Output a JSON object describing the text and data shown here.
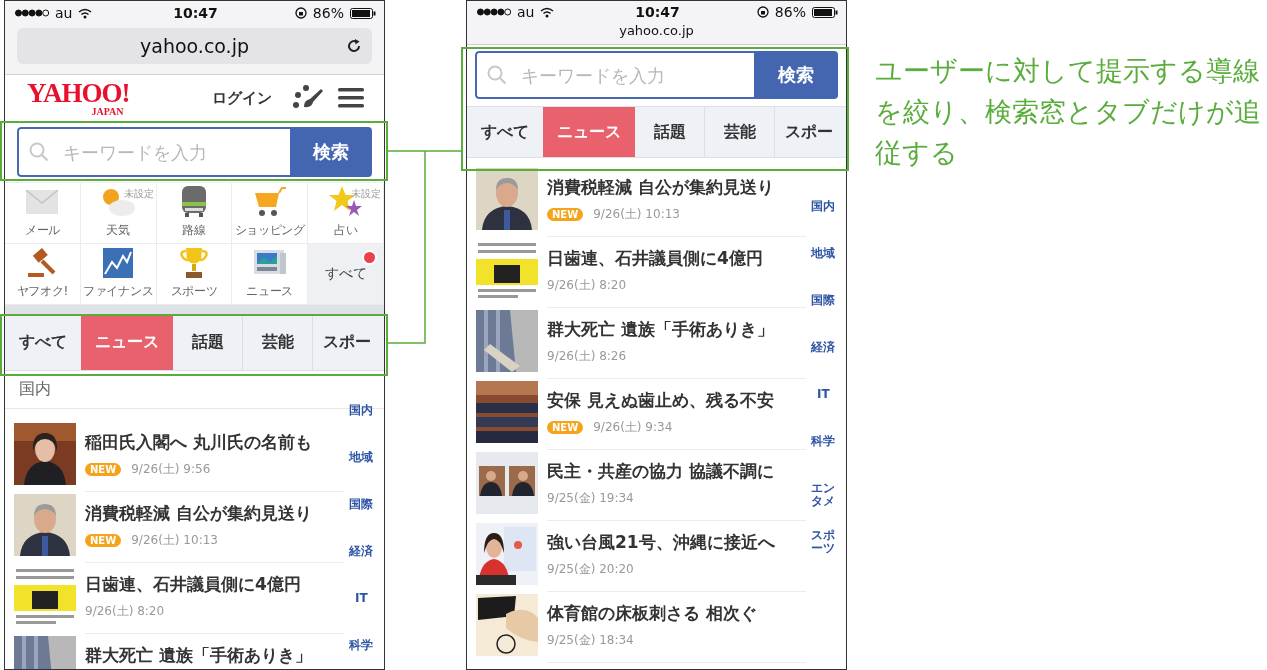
{
  "phones": [
    {
      "kind": "expanded",
      "status": {
        "carrier": "au",
        "time": "10:47",
        "battery": "86%"
      },
      "url": "yahoo.co.jp",
      "header": {
        "logo": "YAHOO!",
        "logo_sub": "JAPAN",
        "login": "ログイン"
      },
      "search": {
        "placeholder": "キーワードを入力",
        "button": "検索"
      },
      "shortcuts": [
        {
          "label": "メール"
        },
        {
          "label": "天気",
          "note": "未設定"
        },
        {
          "label": "路線"
        },
        {
          "label": "ショッピング"
        },
        {
          "label": "占い",
          "note": "未設定"
        },
        {
          "label": "ヤフオク!"
        },
        {
          "label": "ファイナンス"
        },
        {
          "label": "スポーツ"
        },
        {
          "label": "ニュース"
        },
        {
          "label": "すべて",
          "kind": "more",
          "badge": true
        }
      ],
      "tabs": [
        {
          "label": "すべて",
          "selected": false
        },
        {
          "label": "ニュース",
          "selected": true
        },
        {
          "label": "話題",
          "selected": false
        },
        {
          "label": "芸能",
          "selected": false
        },
        {
          "label": "スポー",
          "selected": false
        }
      ],
      "section_title": "国内",
      "news": [
        {
          "title": "稲田氏入閣へ 丸川氏の名前も",
          "badge": "NEW",
          "time": "9/26(土) 9:56"
        },
        {
          "title": "消費税軽減 自公が集約見送り",
          "badge": "NEW",
          "time": "9/26(土) 10:13"
        },
        {
          "title": "日歯連、石井議員側に4億円",
          "time": "9/26(土) 8:20"
        },
        {
          "title": "群大死亡 遺族「手術ありき」"
        }
      ],
      "index": [
        "国内",
        "地域",
        "国際",
        "経済",
        "IT",
        "科学"
      ]
    },
    {
      "kind": "collapsed",
      "status": {
        "carrier": "au",
        "time": "10:47",
        "battery": "86%"
      },
      "url": "yahoo.co.jp",
      "search": {
        "placeholder": "キーワードを入力",
        "button": "検索"
      },
      "tabs": [
        {
          "label": "すべて",
          "selected": false
        },
        {
          "label": "ニュース",
          "selected": true
        },
        {
          "label": "話題",
          "selected": false
        },
        {
          "label": "芸能",
          "selected": false
        },
        {
          "label": "スポー",
          "selected": false
        }
      ],
      "news": [
        {
          "title": "消費税軽減 自公が集約見送り",
          "badge": "NEW",
          "time": "9/26(土) 10:13"
        },
        {
          "title": "日歯連、石井議員側に4億円",
          "time": "9/26(土) 8:20"
        },
        {
          "title": "群大死亡 遺族「手術ありき」",
          "time": "9/26(土) 8:26"
        },
        {
          "title": "安保 見えぬ歯止め、残る不安",
          "badge": "NEW",
          "time": "9/26(土) 9:34"
        },
        {
          "title": "民主・共産の協力 協議不調に",
          "time": "9/25(金) 19:34"
        },
        {
          "title": "強い台風21号、沖縄に接近へ",
          "time": "9/25(金) 20:20"
        },
        {
          "title": "体育館の床板刺さる 相次ぐ",
          "time": "9/25(金) 18:34"
        }
      ],
      "index": [
        "国内",
        "地域",
        "国際",
        "経済",
        "IT",
        "科学",
        "エンタメ",
        "スポーツ"
      ]
    }
  ],
  "annotation": {
    "text": "ユーザーに対して提示する導線を絞り、検索窓とタブだけが追従する"
  }
}
